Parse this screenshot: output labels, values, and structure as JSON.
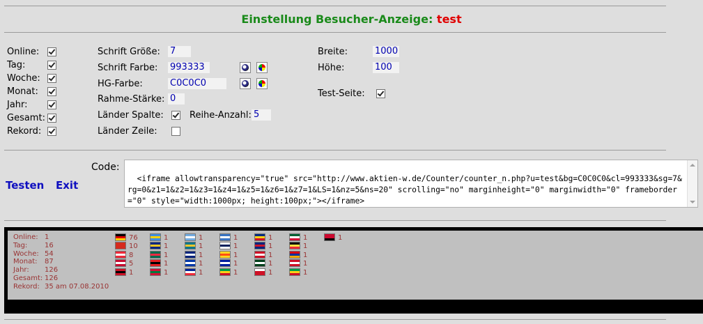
{
  "header": {
    "title": "Einstellung Besucher-Anzeige:",
    "name": "test"
  },
  "counters": [
    {
      "label": "Online:",
      "checked": true
    },
    {
      "label": "Tag:",
      "checked": true
    },
    {
      "label": "Woche:",
      "checked": true
    },
    {
      "label": "Monat:",
      "checked": true
    },
    {
      "label": "Jahr:",
      "checked": true
    },
    {
      "label": "Gesamt:",
      "checked": true
    },
    {
      "label": "Rekord:",
      "checked": true
    }
  ],
  "settings": {
    "font_size_label": "Schrift Größe:",
    "font_size": "7",
    "font_color_label": "Schrift Farbe:",
    "font_color": "993333",
    "bg_color_label": "HG-Farbe:",
    "bg_color": "C0C0C0",
    "border_label": "Rahme-Stärke:",
    "border": "0",
    "countries_col_label": "Länder Spalte:",
    "countries_col_checked": true,
    "rows_label": "Reihe-Anzahl:",
    "rows": "5",
    "countries_row_label": "Länder Zeile:",
    "countries_row_checked": false,
    "width_label": "Breite:",
    "width": "1000",
    "height_label": "Höhe:",
    "height": "100",
    "testpage_label": "Test-Seite:",
    "testpage_checked": true
  },
  "actions": {
    "test": "Testen",
    "exit": "Exit"
  },
  "code": {
    "label": "Code:",
    "value": "<iframe allowtransparency=\"true\" src=\"http://www.aktien-w.de/Counter/counter_n.php?u=test&bg=C0C0C0&cl=993333&sg=7&rg=0&z1=1&z2=1&z3=1&z4=1&z5=1&z6=1&z7=1&LS=1&nz=5&ns=20\" scrolling=\"no\" marginheight=\"0\" marginwidth=\"0\" frameborder=\"0\" style=\"width:1000px; height:100px;\"></iframe>"
  },
  "preview": {
    "stats": [
      {
        "label": "Online:",
        "value": "1"
      },
      {
        "label": "Tag:",
        "value": "16"
      },
      {
        "label": "Woche:",
        "value": "54"
      },
      {
        "label": "Monat:",
        "value": "87"
      },
      {
        "label": "Jahr:",
        "value": "126"
      },
      {
        "label": "Gesamt:",
        "value": "126"
      },
      {
        "label": "Rekord:",
        "value": "35 am 07.08.2010"
      }
    ],
    "flag_columns": [
      [
        {
          "colors": [
            "#000000",
            "#dd0000",
            "#ffce00"
          ],
          "count": "76"
        },
        {
          "colors": [
            "#d52b1e",
            "#d52b1e",
            "#d52b1e"
          ],
          "count": "10"
        },
        {
          "colors": [
            "#ed2939",
            "#ffffff",
            "#ed2939"
          ],
          "count": "8"
        },
        {
          "colors": [
            "#c60c30",
            "#ffffff",
            "#c60c30"
          ],
          "count": "5"
        },
        {
          "colors": [
            "#ce1126",
            "#000000",
            "#ce1126"
          ],
          "count": "1"
        }
      ],
      [
        {
          "colors": [
            "#418fde",
            "#ffd100",
            "#418fde"
          ],
          "count": "1"
        },
        {
          "colors": [
            "#00267f",
            "#ffc726",
            "#00267f"
          ],
          "count": "1"
        },
        {
          "colors": [
            "#006a4e",
            "#f42a41",
            "#006a4e"
          ],
          "count": "1"
        },
        {
          "colors": [
            "#e41e20",
            "#000000",
            "#e41e20"
          ],
          "count": "1"
        },
        {
          "colors": [
            "#d21034",
            "#007a3d",
            "#d21034"
          ],
          "count": "1"
        }
      ],
      [
        {
          "colors": [
            "#74acdf",
            "#ffffff",
            "#74acdf"
          ],
          "count": "1"
        },
        {
          "colors": [
            "#00778b",
            "#ffc72c",
            "#00778b"
          ],
          "count": "1"
        },
        {
          "colors": [
            "#00247d",
            "#ffffff",
            "#00247d"
          ],
          "count": "1"
        },
        {
          "colors": [
            "#0038a8",
            "#ffffff",
            "#0038a8"
          ],
          "count": "1"
        },
        {
          "colors": [
            "#002395",
            "#ffffff",
            "#ed2939"
          ],
          "count": "1"
        }
      ],
      [
        {
          "colors": [
            "#3a75c4",
            "#ffffff",
            "#3a75c4"
          ],
          "count": "1"
        },
        {
          "colors": [
            "#ffffff",
            "#00205b",
            "#ffffff"
          ],
          "count": "1"
        },
        {
          "colors": [
            "#ffd520",
            "#ff4e12",
            "#ffd520"
          ],
          "count": "1"
        },
        {
          "colors": [
            "#00209f",
            "#ffffff",
            "#00209f"
          ],
          "count": "1"
        },
        {
          "colors": [
            "#009e49",
            "#fcd116",
            "#ce1126"
          ],
          "count": "1"
        }
      ],
      [
        {
          "colors": [
            "#002b7f",
            "#fcd116",
            "#ce1126"
          ],
          "count": "1"
        },
        {
          "colors": [
            "#00247d",
            "#cf142b",
            "#00247d"
          ],
          "count": "1"
        },
        {
          "colors": [
            "#ce1126",
            "#ffffff",
            "#ce1126"
          ],
          "count": "1"
        },
        {
          "colors": [
            "#01411c",
            "#ffffff",
            "#01411c"
          ],
          "count": "1"
        },
        {
          "colors": [
            "#ffffff",
            "#ce1126",
            "#ce1126"
          ],
          "count": "1"
        }
      ],
      [
        {
          "colors": [
            "#006233",
            "#ffffff",
            "#d21034"
          ],
          "count": "1"
        },
        {
          "colors": [
            "#000000",
            "#fae042",
            "#ed2939"
          ],
          "count": "1"
        },
        {
          "colors": [
            "#d90012",
            "#0033a0",
            "#f2a800"
          ],
          "count": "1"
        },
        {
          "colors": [
            "#ce1126",
            "#ffffff",
            "#ce1126"
          ],
          "count": "1"
        },
        {
          "colors": [
            "#009e49",
            "#fcd116",
            "#ce1126"
          ],
          "count": "1"
        }
      ],
      [
        {
          "colors": [
            "#cc092f",
            "#cc092f",
            "#000000"
          ],
          "count": "1"
        }
      ]
    ]
  }
}
